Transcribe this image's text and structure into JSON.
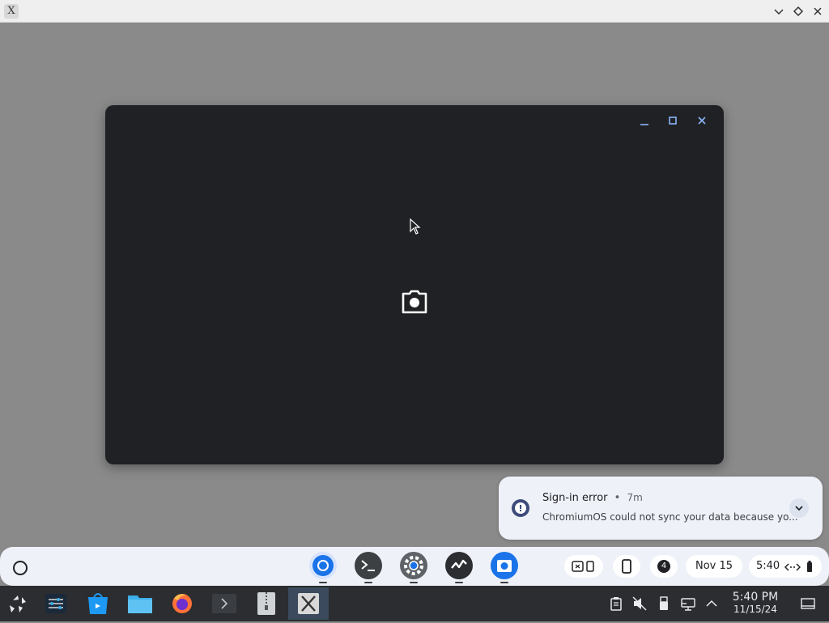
{
  "host_window": {
    "app_icon_glyph": "X",
    "buttons": [
      "chevron-down",
      "diamond",
      "close"
    ]
  },
  "camera_window": {
    "controls": [
      "minimize",
      "maximize",
      "close"
    ],
    "center_icon": "camera-icon"
  },
  "notification": {
    "title": "Sign-in error",
    "separator": "•",
    "age": "7m",
    "body": "ChromiumOS could not sync your data because yo...",
    "icon": "alert-icon"
  },
  "shelf": {
    "apps": [
      "chrome",
      "terminal",
      "settings",
      "diagnostics",
      "camera"
    ],
    "status_badge_count": "4",
    "date": "Nov 15",
    "time": "5:40"
  },
  "taskbar": {
    "clock_time": "5:40 PM",
    "clock_date": "11/15/24"
  },
  "colors": {
    "accent": "#1a73e8",
    "light_accent": "#8ab4f8",
    "desktop": "#8a8a8a",
    "camera_bg": "#202124",
    "taskbar_bg": "#2b2d30"
  }
}
